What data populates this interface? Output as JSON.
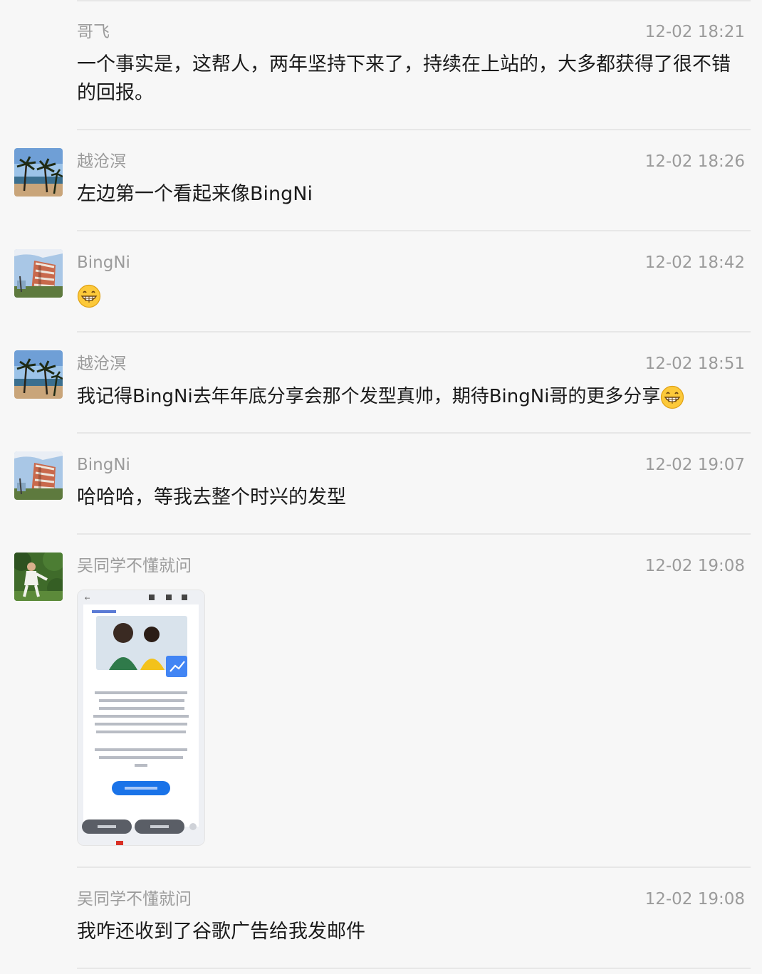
{
  "messages": [
    {
      "name": "哥飞",
      "time": "12-02 18:21",
      "text": "一个事实是，这帮人，两年坚持下来了，持续在上站的，大多都获得了很不错的回报。",
      "avatar": "none"
    },
    {
      "name": "越沧溟",
      "time": "12-02 18:26",
      "text": "左边第一个看起来像BingNi",
      "avatar": "palm-beach"
    },
    {
      "name": "BingNi",
      "time": "12-02 18:42",
      "text": "",
      "emoji": "grin-emoji",
      "avatar": "building"
    },
    {
      "name": "越沧溟",
      "time": "12-02 18:51",
      "text": "我记得BingNi去年年底分享会那个发型真帅，期待BingNi哥的更多分享",
      "emoji": "grin-emoji",
      "avatar": "palm-beach"
    },
    {
      "name": "BingNi",
      "time": "12-02 19:07",
      "text": "哈哈哈，等我去整个时兴的发型",
      "avatar": "building"
    },
    {
      "name": "吴同学不懂就问",
      "time": "12-02 19:08",
      "image": "phone-screenshot-google-analytics-email",
      "avatar": "person-garden"
    },
    {
      "name": "吴同学不懂就问",
      "time": "12-02 19:08",
      "text": "我咋还收到了谷歌广告给我发邮件",
      "avatar": "none"
    }
  ],
  "colors": {
    "background": "#f7f7f7",
    "meta_text": "#9b9b9b",
    "body_text": "#1a1a1a",
    "divider": "#e7e7e7"
  }
}
